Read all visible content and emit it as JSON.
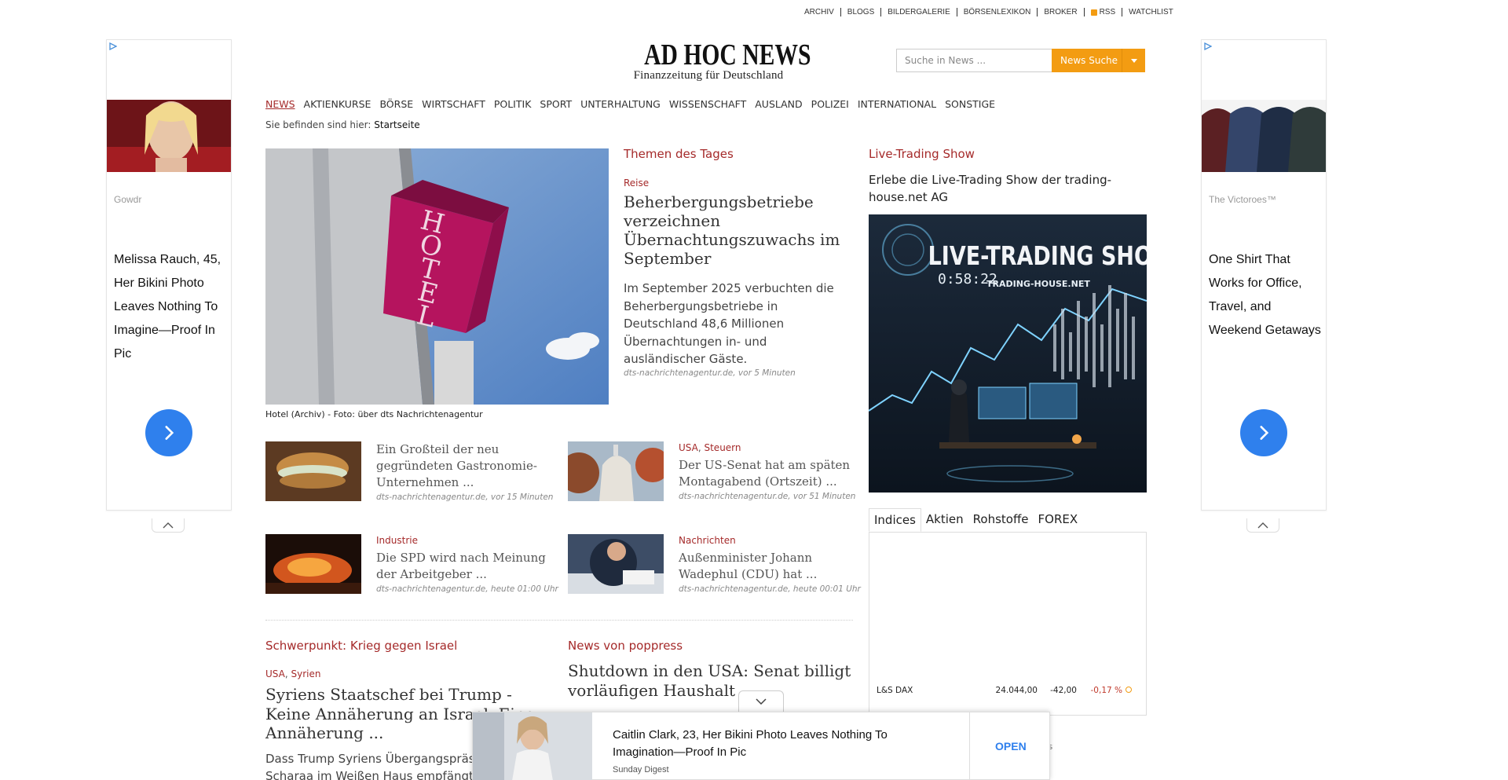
{
  "toplinks": [
    "ARCHIV",
    "BLOGS",
    "BILDERGALERIE",
    "BÖRSENLEXIKON",
    "BROKER",
    "RSS",
    "WATCHLIST"
  ],
  "ads": {
    "left": {
      "source": "Gowdr",
      "headline": "Melissa Rauch, 45, Her Bikini Photo Leaves Nothing To Imagine—Proof In Pic"
    },
    "right": {
      "source": "The Victoroes™",
      "headline": "One Shirt That Works for Office, Travel, and Weekend Getaways"
    },
    "bottom": {
      "headline": "Caitlin Clark, 23, Her Bikini Photo Leaves Nothing To Imagination—Proof In Pic",
      "source": "Sunday Digest",
      "cta": "OPEN"
    }
  },
  "header": {
    "logo_big": "AD HOC NEWS",
    "logo_small": "Finanzzeitung für Deutschland",
    "search_placeholder": "Suche in News ...",
    "search_button": "News Suche"
  },
  "nav": [
    "NEWS",
    "AKTIENKURSE",
    "BÖRSE",
    "WIRTSCHAFT",
    "POLITIK",
    "SPORT",
    "UNTERHALTUNG",
    "WISSENSCHAFT",
    "AUSLAND",
    "POLIZEI",
    "INTERNATIONAL",
    "SONSTIGE"
  ],
  "breadcrumb": {
    "prefix": "Sie befinden sind hier:",
    "current": "Startseite"
  },
  "lead": {
    "caption": "Hotel (Archiv) - Foto: über dts Nachrichtenagentur",
    "section": "Themen des Tages",
    "kicker": "Reise",
    "title": "Beherbergungsbetriebe verzeichnen Übernachtungszuwachs im September",
    "text": "Im September 2025 verbuchten die Beherbergungsbetriebe in Deutschland 48,6 Millionen Übernachtungen in- und ausländischer Gäste.",
    "meta": "dts-nachrichtenagentur.de, vor 5 Minuten"
  },
  "teasers": [
    {
      "kickers": [],
      "title": "Ein Großteil der neu gegründeten Gastronomie-Unternehmen ...",
      "meta": "dts-nachrichtenagentur.de, vor 15 Minuten"
    },
    {
      "kickers": [
        "USA",
        "Steuern"
      ],
      "title": "Der US-Senat hat am späten Montagabend (Ortszeit) ...",
      "meta": "dts-nachrichtenagentur.de, vor 51 Minuten"
    },
    {
      "kickers": [
        "Industrie"
      ],
      "title": "Die SPD wird nach Meinung der Arbeitgeber ...",
      "meta": "dts-nachrichtenagentur.de, heute 01:00 Uhr"
    },
    {
      "kickers": [
        "Nachrichten"
      ],
      "title": "Außenminister Johann Wadephul (CDU) hat ...",
      "meta": "dts-nachrichtenagentur.de, heute 00:01 Uhr"
    }
  ],
  "focus": {
    "section": "Schwerpunkt: Krieg gegen Israel",
    "kicker1": "USA",
    "kicker2": "Syrien",
    "title": "Syriens Staatschef bei Trump - Keine Annäherung an Israel. Eine Annäherung ...",
    "text": "Dass Trump Syriens Übergangspräsident al-Scharaa im Weißen Haus empfängt"
  },
  "poppress": {
    "section": "News von poppress",
    "title": "Shutdown in den USA: Senat billigt vorläufigen Haushalt"
  },
  "live": {
    "section": "Live-Trading Show",
    "subtitle": "Erlebe die Live-Trading Show der trading-house.net AG",
    "img_title": "LIVE-TRADING SHOW",
    "img_clock": "0:58:22",
    "img_sub": "TRADING-HOUSE.NET"
  },
  "market": {
    "tabs": [
      "Indices",
      "Aktien",
      "Rohstoffe",
      "FOREX"
    ],
    "row": {
      "name": "L&S DAX",
      "value": "24.044,00",
      "change": "-42,00",
      "pct": "-0,17 %"
    },
    "footer_partial": "rs"
  }
}
